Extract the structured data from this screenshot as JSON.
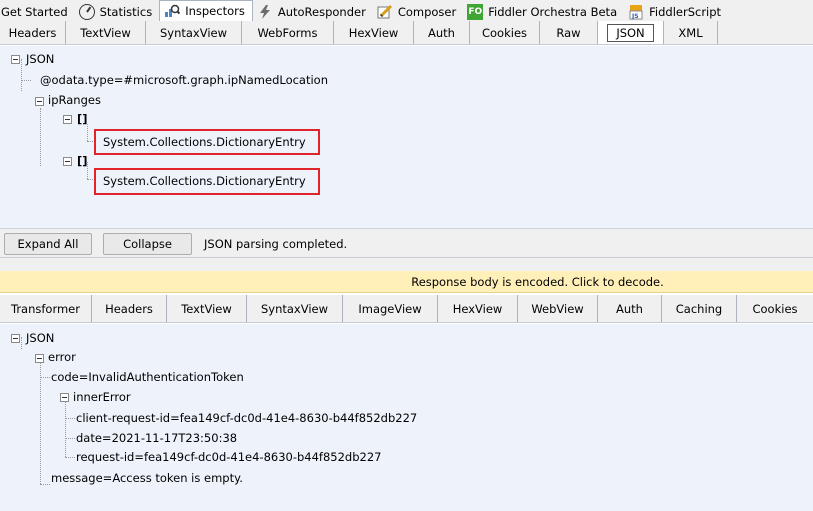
{
  "main_tabs": [
    {
      "label": "Get Started",
      "icon": "none"
    },
    {
      "label": "Statistics",
      "icon": "stopwatch-icon"
    },
    {
      "label": "Inspectors",
      "icon": "magnifier-icon"
    },
    {
      "label": "AutoResponder",
      "icon": "lightning-icon"
    },
    {
      "label": "Composer",
      "icon": "pencil-icon"
    },
    {
      "label": "Fiddler Orchestra Beta",
      "icon": "fo-icon",
      "badge": "FO"
    },
    {
      "label": "FiddlerScript",
      "icon": "script-icon",
      "badge": "JS"
    }
  ],
  "request_tabs": [
    "Headers",
    "TextView",
    "SyntaxView",
    "WebForms",
    "HexView",
    "Auth",
    "Cookies",
    "Raw",
    "JSON",
    "XML"
  ],
  "request_selected_tab": "JSON",
  "request_tree": {
    "root": "JSON",
    "odata_type": "@odata.type=#microsoft.graph.ipNamedLocation",
    "ip_ranges": "ipRanges",
    "bracket_1": "[]",
    "entry_1": "System.Collections.DictionaryEntry",
    "bracket_2": "[]",
    "entry_2": "System.Collections.DictionaryEntry"
  },
  "buttons": {
    "expand_all": "Expand All",
    "collapse": "Collapse"
  },
  "status_text": "JSON parsing completed.",
  "encoded_notice": "Response body is encoded. Click to decode.",
  "response_tabs": [
    "Transformer",
    "Headers",
    "TextView",
    "SyntaxView",
    "ImageView",
    "HexView",
    "WebView",
    "Auth",
    "Caching",
    "Cookies"
  ],
  "response_tree": {
    "root": "JSON",
    "error": "error",
    "code": "code=InvalidAuthenticationToken",
    "inner_error": "innerError",
    "client_request_id": "client-request-id=fea149cf-dc0d-41e4-8630-b44f852db227",
    "date": "date=2021-11-17T23:50:38",
    "request_id": "request-id=fea149cf-dc0d-41e4-8630-b44f852db227",
    "message": "message=Access token is empty."
  },
  "colors": {
    "highlight_box": "#e0242a",
    "tree_background": "#eef3fb",
    "notice_background": "#ffefb8"
  }
}
